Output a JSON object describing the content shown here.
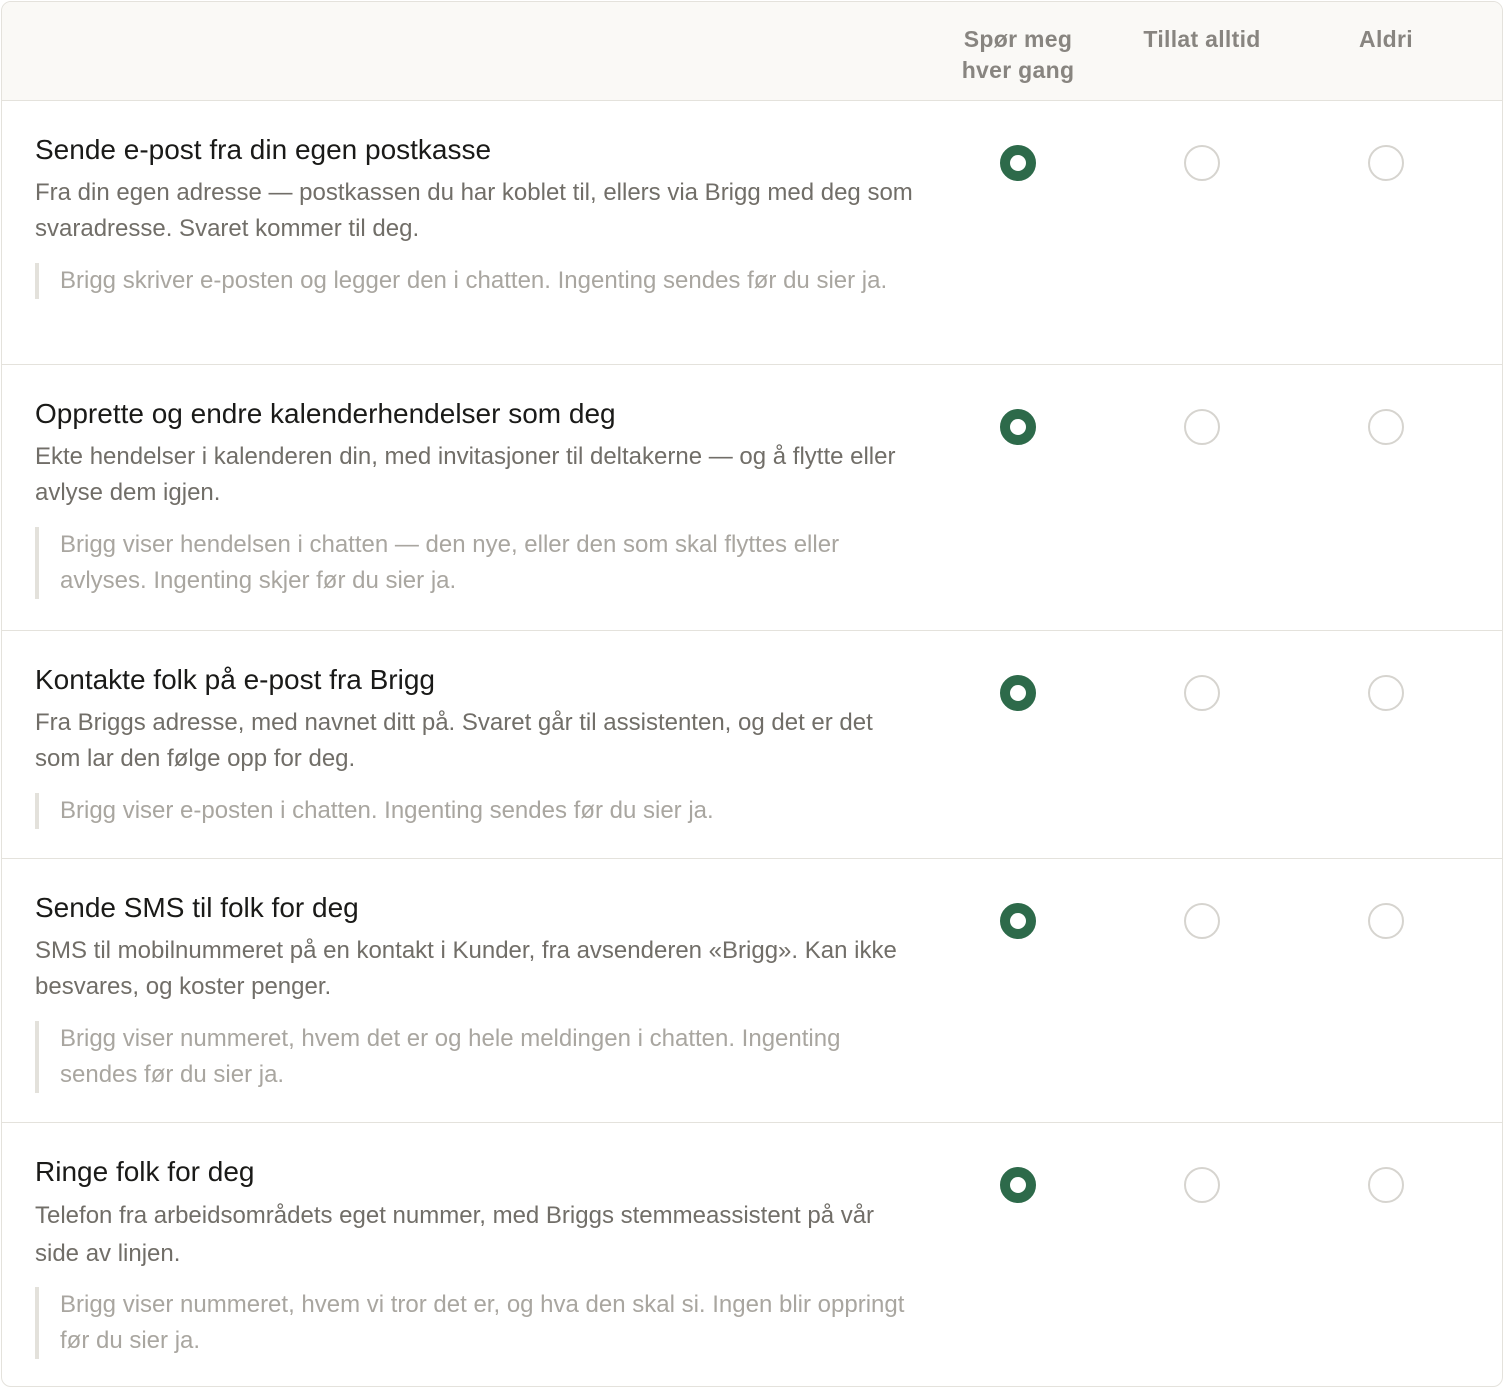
{
  "columns": [
    "Spør meg\nhver gang",
    "Tillat alltid",
    "Aldri"
  ],
  "accent_color": "#2d6a4a",
  "rows": [
    {
      "title": "Sende e-post fra din egen postkasse",
      "description": "Fra din egen adresse — postkassen du har koblet til, ellers via Brigg med deg som svaradresse. Svaret kommer til deg.",
      "note": "Brigg skriver e-posten og legger den i chatten. Ingenting sendes før du sier ja.",
      "selected": 0
    },
    {
      "title": "Opprette og endre kalenderhendelser som deg",
      "description": "Ekte hendelser i kalenderen din, med invitasjoner til deltakerne — og å flytte eller avlyse dem igjen.",
      "note": "Brigg viser hendelsen i chatten — den nye, eller den som skal flyttes eller avlyses. Ingenting skjer før du sier ja.",
      "selected": 0
    },
    {
      "title": "Kontakte folk på e-post fra Brigg",
      "description": "Fra Briggs adresse, med navnet ditt på. Svaret går til assistenten, og det er det som lar den følge opp for deg.",
      "note": "Brigg viser e-posten i chatten. Ingenting sendes før du sier ja.",
      "selected": 0
    },
    {
      "title": "Sende SMS til folk for deg",
      "description": "SMS til mobilnummeret på en kontakt i Kunder, fra avsenderen «Brigg». Kan ikke besvares, og koster penger.",
      "note": "Brigg viser nummeret, hvem det er og hele meldingen i chatten. Ingenting sendes før du sier ja.",
      "selected": 0
    },
    {
      "title": "Ringe folk for deg",
      "description": "Telefon fra arbeidsområdets eget nummer, med Briggs stemmeassistent på vår side av linjen.",
      "note": "Brigg viser nummeret, hvem vi tror det er, og hva den skal si. Ingen blir oppringt før du sier ja.",
      "selected": 0
    }
  ]
}
